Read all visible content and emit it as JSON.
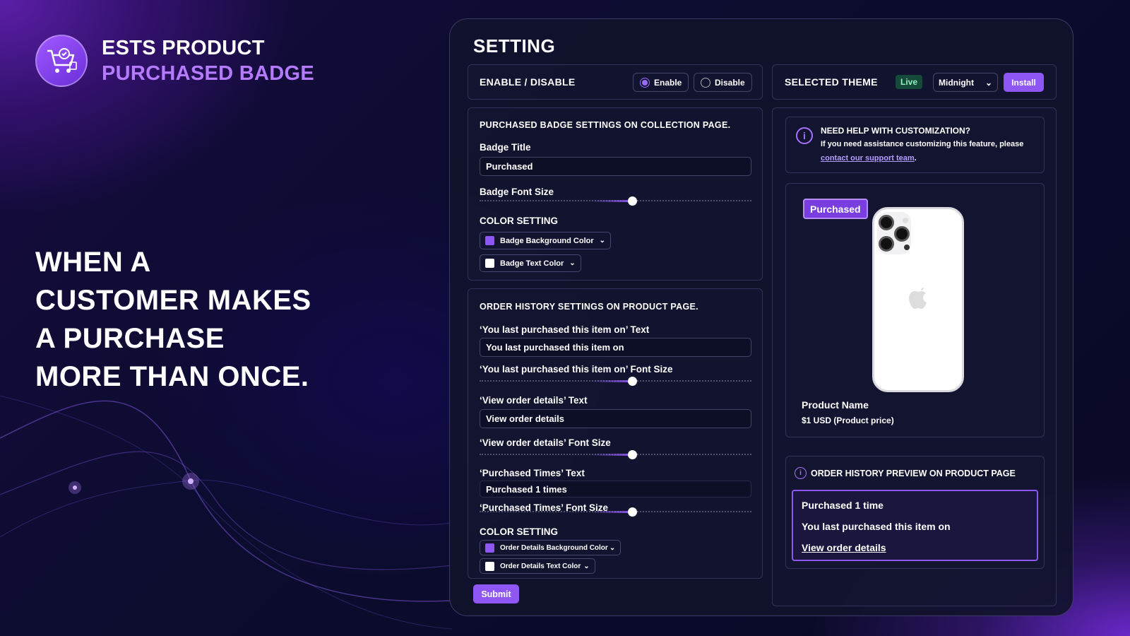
{
  "brand": {
    "line1": "ESTS PRODUCT",
    "line2": "PURCHASED BADGE",
    "logo_icon": "shopping-cart-icon"
  },
  "hero": {
    "lines": [
      "WHEN A",
      "CUSTOMER MAKES",
      "A PURCHASE",
      "MORE THAN ONCE."
    ]
  },
  "settings": {
    "title": "SETTING",
    "enable_disable": {
      "label": "ENABLE / DISABLE",
      "options": [
        "Enable",
        "Disable"
      ],
      "selected": "Enable"
    },
    "theme": {
      "label": "SELECTED THEME",
      "status": "Live",
      "value": "Midnight",
      "install_label": "Install"
    },
    "collection": {
      "section_title": "PURCHASED BADGE SETTINGS ON COLLECTION PAGE.",
      "badge_title_label": "Badge Title",
      "badge_title_value": "Purchased",
      "font_size_label": "Badge Font Size",
      "font_size_level": 0.56,
      "color_title": "COLOR SETTING",
      "bg_color_label": "Badge Background Color",
      "bg_color": "#8e57f5",
      "text_color_label": "Badge Text Color",
      "text_color": "#ffffff"
    },
    "order_history": {
      "section_title": "ORDER HISTORY SETTINGS ON PRODUCT PAGE.",
      "last_purchased_label": "‘You last purchased this item on’ Text",
      "last_purchased_value": "You last purchased this item on",
      "last_purchased_size_label": "‘You last purchased this item on’ Font Size",
      "last_purchased_size_level": 0.56,
      "view_details_label": "‘View order details’ Text",
      "view_details_value": "View order details",
      "view_details_size_label": "‘View order details’ Font Size",
      "view_details_size_level": 0.56,
      "purchased_times_label": "‘Purchased Times’ Text",
      "purchased_times_value": "Purchased 1 times",
      "purchased_times_size_label": "‘Purchased Times’ Font Size",
      "purchased_times_size_level": 0.56,
      "color_title": "COLOR SETTING",
      "bg_color_label": "Order Details Background Color",
      "bg_color": "#8e57f5",
      "text_color_label": "Order Details Text Color",
      "text_color": "#ffffff"
    },
    "submit_label": "Submit"
  },
  "help": {
    "title": "NEED HELP WITH CUSTOMIZATION?",
    "text": "If you need assistance customizing this feature, please",
    "link": "contact our support team",
    "suffix": "."
  },
  "product_preview": {
    "badge": "Purchased",
    "name": "Product Name",
    "price": "$1 USD (Product price)"
  },
  "order_preview": {
    "title": "ORDER HISTORY PREVIEW ON PRODUCT PAGE",
    "line1": "Purchased 1 time",
    "line2": "You last purchased this item on",
    "link": "View order details"
  }
}
